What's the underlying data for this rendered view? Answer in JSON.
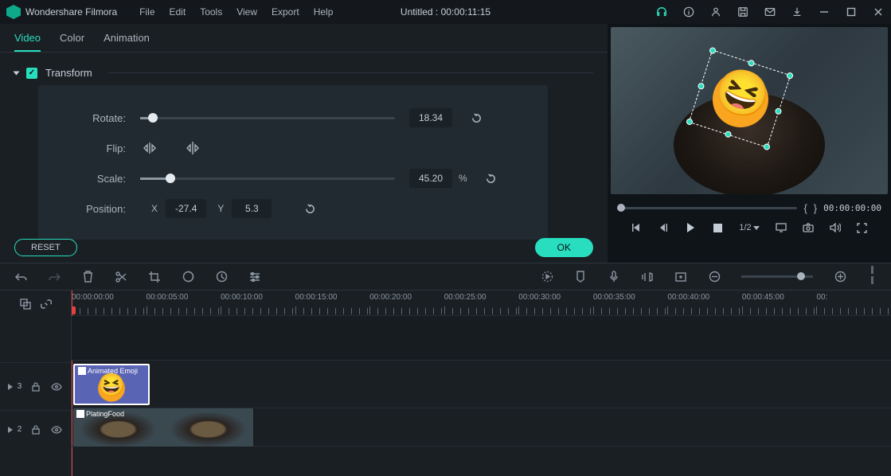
{
  "app": {
    "title": "Wondershare Filmora"
  },
  "menu": {
    "file": "File",
    "edit": "Edit",
    "tools": "Tools",
    "view": "View",
    "export": "Export",
    "help": "Help"
  },
  "title_center": "Untitled : 00:00:11:15",
  "tabs": {
    "video": "Video",
    "color": "Color",
    "animation": "Animation"
  },
  "transform": {
    "section": "Transform",
    "rotate_label": "Rotate:",
    "rotate_value": "18.34",
    "flip_label": "Flip:",
    "scale_label": "Scale:",
    "scale_value": "45.20",
    "scale_suffix": "%",
    "position_label": "Position:",
    "x_label": "X",
    "x_value": "-27.4",
    "y_label": "Y",
    "y_value": "5.3"
  },
  "buttons": {
    "reset": "RESET",
    "ok": "OK"
  },
  "preview": {
    "time": "00:00:00:00",
    "ratio": "1/2"
  },
  "ruler": [
    "00:00:00:00",
    "00:00:05:00",
    "00:00:10:00",
    "00:00:15:00",
    "00:00:20:00",
    "00:00:25:00",
    "00:00:30:00",
    "00:00:35:00",
    "00:00:40:00",
    "00:00:45:00",
    "00:"
  ],
  "tracks": {
    "layer3": "3",
    "layer2": "2"
  },
  "clips": {
    "emoji": "Animated Emoji",
    "food": "PlatingFood"
  }
}
